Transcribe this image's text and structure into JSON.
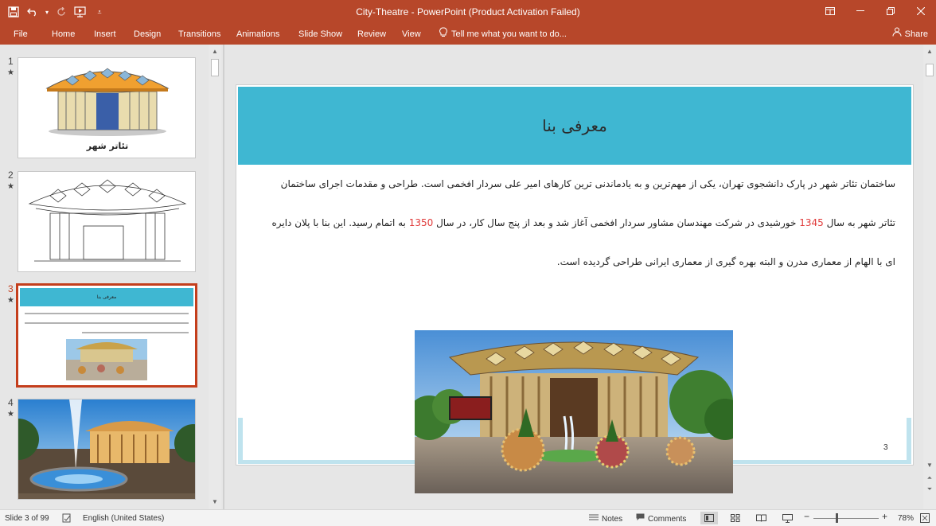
{
  "window": {
    "title": "City-Theatre - PowerPoint (Product Activation Failed)"
  },
  "qat": {
    "save_icon": "save-icon",
    "undo_icon": "undo-icon",
    "redo_icon": "redo-icon",
    "start_icon": "start-from-beginning-icon",
    "customize_icon": "customize-qat-icon"
  },
  "ribbon": {
    "tabs": [
      "File",
      "Home",
      "Insert",
      "Design",
      "Transitions",
      "Animations",
      "Slide Show",
      "Review",
      "View"
    ],
    "tell_me": "Tell me what you want to do...",
    "share": "Share"
  },
  "thumbnails": [
    {
      "number": "1",
      "star": "★",
      "caption": "تئاتر شهر"
    },
    {
      "number": "2",
      "star": "★"
    },
    {
      "number": "3",
      "star": "★",
      "title": "معرفی بنا",
      "selected": true
    },
    {
      "number": "4",
      "star": "★"
    }
  ],
  "slide": {
    "title": "معرفی بنا",
    "lines": [
      {
        "text": "ساختمان تئاتر شهر در پارک دانشجوی تهران، یکی از مهم‌ترین و به یادماندنی ترین کارهای امیر علی سردار افخمی است. طراحی و مقدمات اجرای ساختمان"
      },
      {
        "before": "تئاتر شهر به سال ",
        "year1": "1345",
        "middle": " خورشیدی در شرکت مهندسان مشاور سردار افخمی آغاز شد و بعد از پنج سال کار، در سال ",
        "year2": "1350",
        "after": " به اتمام رسید. این بنا با پلان دایره"
      },
      {
        "text": "ای با الهام از معماری مدرن و البته بهره گیری از معماری ایرانی طراحی گردیده است."
      }
    ],
    "page_number": "3"
  },
  "statusbar": {
    "slide_info": "Slide 3 of 99",
    "language": "English (United States)",
    "notes": "Notes",
    "comments": "Comments",
    "zoom": "78%"
  },
  "colors": {
    "accent": "#b7472a",
    "slide_title_bg": "#3fb7d2",
    "highlight_red": "#e03a3a"
  }
}
